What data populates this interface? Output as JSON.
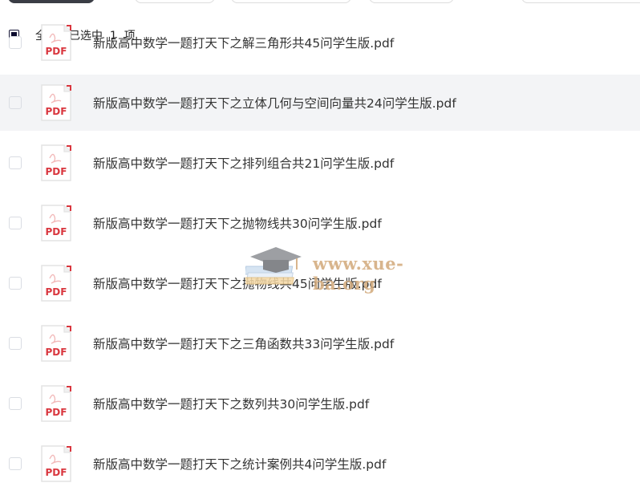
{
  "toolbar": {
    "buttons": [
      "primary",
      "b2",
      "b3",
      "b4",
      "b5"
    ]
  },
  "selection": {
    "select_all_label": "全选",
    "selected_label": "已选中  1  项"
  },
  "files": [
    {
      "name": "新版高中数学一题打天下之解三角形共45问学生版.pdf",
      "selected": false
    },
    {
      "name": "新版高中数学一题打天下之立体几何与空间向量共24问学生版.pdf",
      "selected": false,
      "hovered": true
    },
    {
      "name": "新版高中数学一题打天下之排列组合共21问学生版.pdf",
      "selected": false
    },
    {
      "name": "新版高中数学一题打天下之抛物线共30问学生版.pdf",
      "selected": false
    },
    {
      "name": "新版高中数学一题打天下之抛物线共45问学生版.pdf",
      "selected": false
    },
    {
      "name": "新版高中数学一题打天下之三角函数共33问学生版.pdf",
      "selected": false
    },
    {
      "name": "新版高中数学一题打天下之数列共30问学生版.pdf",
      "selected": false
    },
    {
      "name": "新版高中数学一题打天下之统计案例共4问学生版.pdf",
      "selected": false
    }
  ],
  "file_icon_label": "PDF",
  "watermark": {
    "text": "www.xue-ba.org"
  },
  "colors": {
    "pdf_red": "#d9363e",
    "hover_bg": "#f3f4f6",
    "text": "#333333",
    "watermark": "#d2a97a"
  }
}
